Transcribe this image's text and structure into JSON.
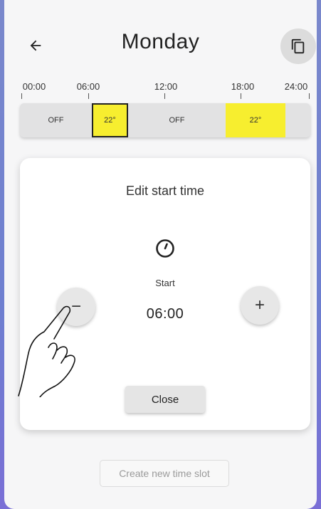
{
  "header": {
    "title": "Monday",
    "back_icon": "arrow-left-icon",
    "copy_icon": "copy-icon"
  },
  "timeline": {
    "ticks": [
      "00:00",
      "06:00",
      "12:00",
      "18:00",
      "24:00"
    ],
    "slots": [
      {
        "label": "OFF",
        "state": "off"
      },
      {
        "label": "22°",
        "state": "on",
        "selected": true
      },
      {
        "label": "OFF",
        "state": "off"
      },
      {
        "label": "22°",
        "state": "on"
      }
    ],
    "active_color": "#f7ee2f"
  },
  "dialog": {
    "title": "Edit start time",
    "clock_icon": "clock-icon",
    "field_label": "Start",
    "time_value": "06:00",
    "decrement_label": "−",
    "increment_label": "+",
    "close_label": "Close"
  },
  "footer": {
    "create_label": "Create new time slot"
  },
  "overlay": {
    "gesture_icon": "tap-hand-icon"
  }
}
